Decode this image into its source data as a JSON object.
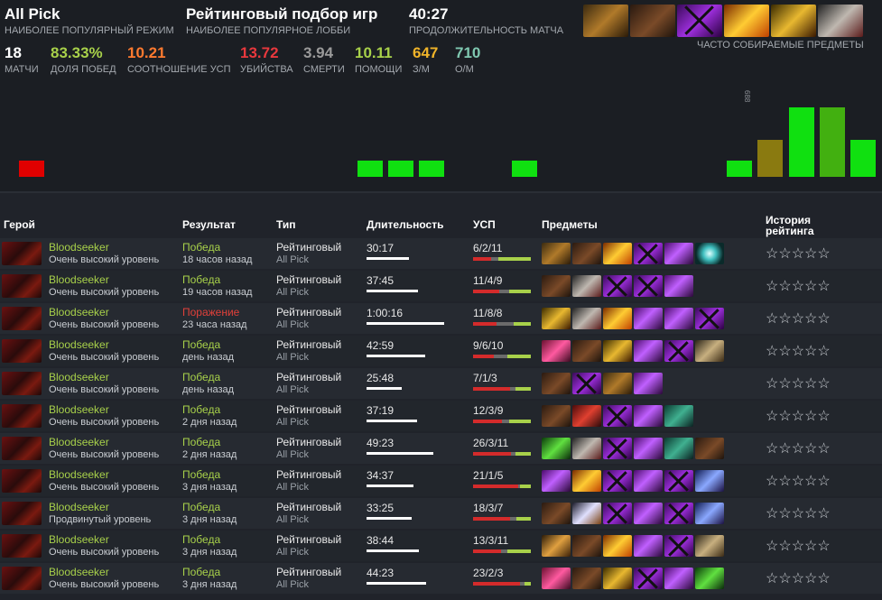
{
  "header": {
    "mode": {
      "value": "All Pick",
      "label": "НАИБОЛЕЕ ПОПУЛЯРНЫЙ РЕЖИМ"
    },
    "lobby": {
      "value": "Рейтинговый подбор игр",
      "label": "НАИБОЛЕЕ ПОПУЛЯРНОЕ ЛОББИ"
    },
    "duration": {
      "value": "40:27",
      "label": "ПРОДОЛЖИТЕЛЬНОСТЬ МАТЧА"
    },
    "frequent_items_label": "ЧАСТО СОБИРАЕМЫЕ ПРЕДМЕТЫ",
    "frequent_items": [
      "claws-icon",
      "boots-icon",
      "blade-icon",
      "fire-sword-icon",
      "helm-icon",
      "skull-icon"
    ]
  },
  "stats": [
    {
      "value": "18",
      "label": "МАТЧИ",
      "color": "#ffffff"
    },
    {
      "value": "83.33%",
      "label": "ДОЛЯ ПОБЕД",
      "color": "#a8d14a"
    },
    {
      "value": "10.21",
      "label": "СООТНОШЕНИЕ УСП",
      "color": "#ff7a2f"
    },
    {
      "value": "13.72",
      "label": "УБИЙСТВА",
      "color": "#e8383d"
    },
    {
      "value": "3.94",
      "label": "СМЕРТИ",
      "color": "#9a9a9a"
    },
    {
      "value": "10.11",
      "label": "ПОМОЩИ",
      "color": "#a8d14a"
    },
    {
      "value": "647",
      "label": "З/М",
      "color": "#f0b429"
    },
    {
      "value": "710",
      "label": "О/М",
      "color": "#7fc8b0"
    }
  ],
  "histogram": {
    "label": "688",
    "colors": {
      "loss": "#e00000",
      "win": "#10e010",
      "win_dark": "#42b010",
      "peak": "#8a7a10"
    },
    "bars": [
      {
        "level": 0.24,
        "kind": "loss"
      },
      {
        "level": 0,
        "kind": "none"
      },
      {
        "level": 0,
        "kind": "none"
      },
      {
        "level": 0,
        "kind": "none"
      },
      {
        "level": 0,
        "kind": "none"
      },
      {
        "level": 0,
        "kind": "none"
      },
      {
        "level": 0,
        "kind": "none"
      },
      {
        "level": 0,
        "kind": "none"
      },
      {
        "level": 0,
        "kind": "none"
      },
      {
        "level": 0,
        "kind": "none"
      },
      {
        "level": 0,
        "kind": "none"
      },
      {
        "level": 0.24,
        "kind": "win"
      },
      {
        "level": 0.24,
        "kind": "win"
      },
      {
        "level": 0.24,
        "kind": "win"
      },
      {
        "level": 0,
        "kind": "none"
      },
      {
        "level": 0,
        "kind": "none"
      },
      {
        "level": 0.24,
        "kind": "win"
      },
      {
        "level": 0,
        "kind": "none"
      },
      {
        "level": 0,
        "kind": "none"
      },
      {
        "level": 0,
        "kind": "none"
      },
      {
        "level": 0,
        "kind": "none"
      },
      {
        "level": 0,
        "kind": "none"
      },
      {
        "level": 0,
        "kind": "none"
      },
      {
        "level": 0.24,
        "kind": "win"
      },
      {
        "level": 0.53,
        "kind": "peak"
      },
      {
        "level": 1.0,
        "kind": "win"
      },
      {
        "level": 1.0,
        "kind": "win_dark"
      },
      {
        "level": 0.53,
        "kind": "win"
      }
    ]
  },
  "table": {
    "columns": {
      "hero": "Герой",
      "result": "Результат",
      "type": "Тип",
      "duration": "Длительность",
      "kda": "УСП",
      "items": "Предметы",
      "rating": "История рейтинга"
    },
    "rows": [
      {
        "hero": "Bloodseeker",
        "level": "Очень высокий уровень",
        "result": "Победа",
        "win": true,
        "ago": "18 часов назад",
        "type": "Рейтинговый",
        "mode": "All Pick",
        "duration": "30:17",
        "dur_frac": 0.55,
        "kda": "6/2/11",
        "kda_parts": [
          0.32,
          0.11,
          0.57
        ],
        "items": [
          "claws",
          "boots",
          "fire",
          "x",
          "blade",
          "glow"
        ]
      },
      {
        "hero": "Bloodseeker",
        "level": "Очень высокий уровень",
        "result": "Победа",
        "win": true,
        "ago": "19 часов назад",
        "type": "Рейтинговый",
        "mode": "All Pick",
        "duration": "37:45",
        "dur_frac": 0.66,
        "kda": "11/4/9",
        "kda_parts": [
          0.46,
          0.17,
          0.37
        ],
        "items": [
          "boots",
          "skull",
          "x",
          "x",
          "blade"
        ]
      },
      {
        "hero": "Bloodseeker",
        "level": "Очень высокий уровень",
        "result": "Поражение",
        "win": false,
        "ago": "23 часа назад",
        "type": "Рейтинговый",
        "mode": "All Pick",
        "duration": "1:00:16",
        "dur_frac": 1.0,
        "kda": "11/8/8",
        "kda_parts": [
          0.41,
          0.3,
          0.29
        ],
        "items": [
          "helm",
          "skull",
          "fire",
          "blade",
          "blade",
          "x"
        ]
      },
      {
        "hero": "Bloodseeker",
        "level": "Очень высокий уровень",
        "result": "Победа",
        "win": true,
        "ago": "день назад",
        "type": "Рейтинговый",
        "mode": "All Pick",
        "duration": "42:59",
        "dur_frac": 0.75,
        "kda": "9/6/10",
        "kda_parts": [
          0.36,
          0.24,
          0.4
        ],
        "items": [
          "pink",
          "boots",
          "helm",
          "blade",
          "x",
          "scroll"
        ]
      },
      {
        "hero": "Bloodseeker",
        "level": "Очень высокий уровень",
        "result": "Победа",
        "win": true,
        "ago": "день назад",
        "type": "Рейтинговый",
        "mode": "All Pick",
        "duration": "25:48",
        "dur_frac": 0.45,
        "kda": "7/1/3",
        "kda_parts": [
          0.64,
          0.09,
          0.27
        ],
        "items": [
          "boots",
          "x",
          "claws",
          "blade"
        ]
      },
      {
        "hero": "Bloodseeker",
        "level": "Очень высокий уровень",
        "result": "Победа",
        "win": true,
        "ago": "2 дня назад",
        "type": "Рейтинговый",
        "mode": "All Pick",
        "duration": "37:19",
        "dur_frac": 0.65,
        "kda": "12/3/9",
        "kda_parts": [
          0.5,
          0.13,
          0.37
        ],
        "items": [
          "boots",
          "red",
          "x",
          "blade",
          "teal"
        ]
      },
      {
        "hero": "Bloodseeker",
        "level": "Очень высокий уровень",
        "result": "Победа",
        "win": true,
        "ago": "2 дня назад",
        "type": "Рейтинговый",
        "mode": "All Pick",
        "duration": "49:23",
        "dur_frac": 0.86,
        "kda": "26/3/11",
        "kda_parts": [
          0.65,
          0.08,
          0.27
        ],
        "items": [
          "green",
          "skull",
          "x",
          "blade",
          "teal",
          "boots"
        ]
      },
      {
        "hero": "Bloodseeker",
        "level": "Очень высокий уровень",
        "result": "Победа",
        "win": true,
        "ago": "3 дня назад",
        "type": "Рейтинговый",
        "mode": "All Pick",
        "duration": "34:37",
        "dur_frac": 0.6,
        "kda": "21/1/5",
        "kda_parts": [
          0.78,
          0.04,
          0.18
        ],
        "items": [
          "blade",
          "fire",
          "x",
          "blade",
          "x",
          "blue"
        ]
      },
      {
        "hero": "Bloodseeker",
        "level": "Продвинутый уровень",
        "result": "Победа",
        "win": true,
        "ago": "3 дня назад",
        "type": "Рейтинговый",
        "mode": "All Pick",
        "duration": "33:25",
        "dur_frac": 0.58,
        "kda": "18/3/7",
        "kda_parts": [
          0.64,
          0.11,
          0.25
        ],
        "items": [
          "boots",
          "sword",
          "x",
          "blade",
          "x",
          "blue"
        ]
      },
      {
        "hero": "Bloodseeker",
        "level": "Очень высокий уровень",
        "result": "Победа",
        "win": true,
        "ago": "3 дня назад",
        "type": "Рейтинговый",
        "mode": "All Pick",
        "duration": "38:44",
        "dur_frac": 0.67,
        "kda": "13/3/11",
        "kda_parts": [
          0.48,
          0.11,
          0.41
        ],
        "items": [
          "rod",
          "boots",
          "fire",
          "blade",
          "x",
          "scroll"
        ]
      },
      {
        "hero": "Bloodseeker",
        "level": "Очень высокий уровень",
        "result": "Победа",
        "win": true,
        "ago": "3 дня назад",
        "type": "Рейтинговый",
        "mode": "All Pick",
        "duration": "44:23",
        "dur_frac": 0.77,
        "kda": "23/2/3",
        "kda_parts": [
          0.82,
          0.07,
          0.11
        ],
        "items": [
          "pink",
          "boots",
          "helm",
          "x",
          "blade",
          "green"
        ]
      }
    ],
    "kda_colors": [
      "#d42b2b",
      "#6b6b6b",
      "#a8d14a"
    ],
    "stars": "☆☆☆☆☆"
  }
}
